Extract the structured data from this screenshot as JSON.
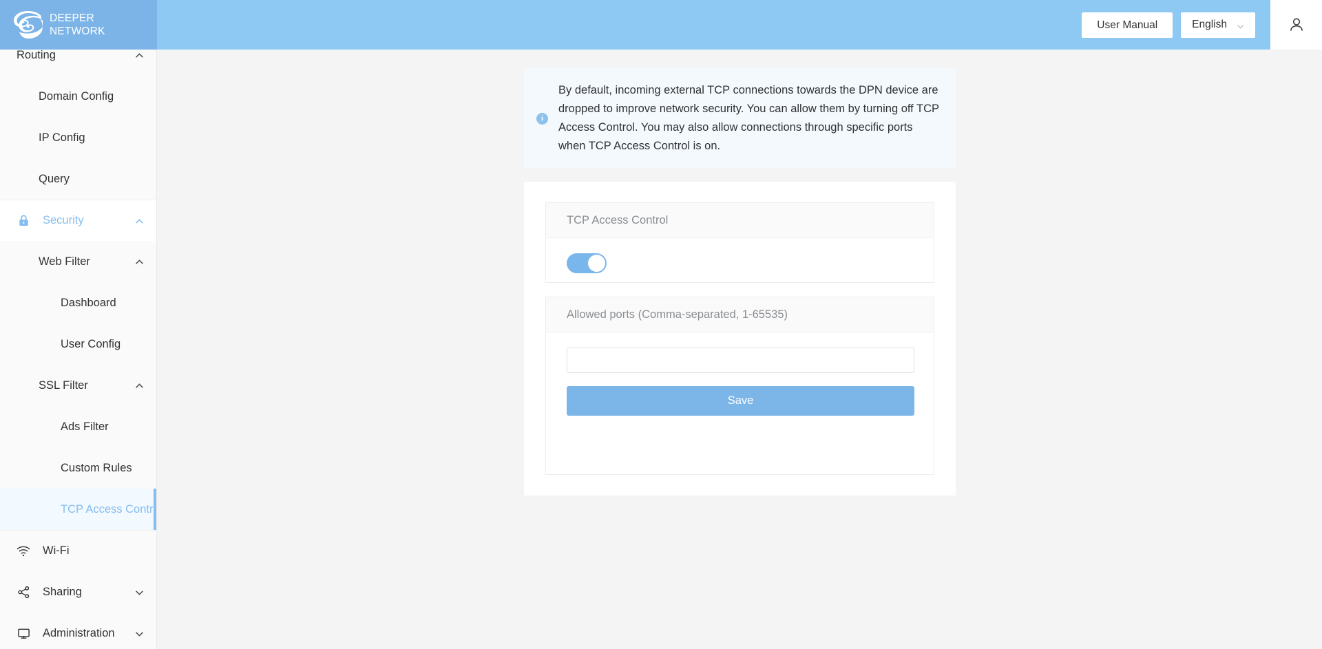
{
  "header": {
    "brand_name": "DEEPER\nNETWORK",
    "logo_icon": "deeper-spiral-logo",
    "user_manual_label": "User Manual",
    "language_value": "English",
    "language_caret_icon": "chevron-down-icon",
    "account_icon": "user-icon"
  },
  "sidebar": {
    "items": [
      {
        "label": "Routing",
        "level": "group",
        "icon": "",
        "caret": "chevron-up-icon",
        "active": false
      },
      {
        "label": "Domain Config",
        "level": "sub1",
        "icon": "",
        "caret": "",
        "active": false
      },
      {
        "label": "IP Config",
        "level": "sub1",
        "icon": "",
        "caret": "",
        "active": false
      },
      {
        "label": "Query",
        "level": "sub1",
        "icon": "",
        "caret": "",
        "active": false
      },
      {
        "label": "Security",
        "level": "group",
        "icon": "lock-icon",
        "caret": "chevron-up-icon",
        "active": false,
        "highlight": true
      },
      {
        "label": "Web Filter",
        "level": "sub1",
        "icon": "",
        "caret": "chevron-up-icon",
        "active": false
      },
      {
        "label": "Dashboard",
        "level": "sub2",
        "icon": "",
        "caret": "",
        "active": false
      },
      {
        "label": "User Config",
        "level": "sub2",
        "icon": "",
        "caret": "",
        "active": false
      },
      {
        "label": "SSL Filter",
        "level": "sub1",
        "icon": "",
        "caret": "chevron-up-icon",
        "active": false
      },
      {
        "label": "Ads Filter",
        "level": "sub2",
        "icon": "",
        "caret": "",
        "active": false
      },
      {
        "label": "Custom Rules",
        "level": "sub2",
        "icon": "",
        "caret": "",
        "active": false
      },
      {
        "label": "TCP Access Control",
        "level": "sub2",
        "icon": "",
        "caret": "",
        "active": true
      },
      {
        "label": "Wi-Fi",
        "level": "group",
        "icon": "wifi-icon",
        "caret": "",
        "active": false
      },
      {
        "label": "Sharing",
        "level": "group",
        "icon": "share-nodes-icon",
        "caret": "chevron-down-icon",
        "active": false
      },
      {
        "label": "Administration",
        "level": "group",
        "icon": "monitor-icon",
        "caret": "chevron-down-icon",
        "active": false
      }
    ]
  },
  "main": {
    "banner": {
      "icon": "info-circle-icon",
      "icon_glyph": "i",
      "text": "By default, incoming external TCP connections towards the DPN device are dropped to improve network security. You can allow them by turning off TCP Access Control. You may also allow connections through specific ports when TCP Access Control is on."
    },
    "access_card": {
      "title": "TCP Access Control",
      "toggle_on": true
    },
    "ports_card": {
      "title": "Allowed ports (Comma-separated, 1-65535)",
      "input_value": "",
      "input_placeholder": "",
      "save_label": "Save"
    }
  },
  "colors": {
    "brand_blue": "#7cb4e8",
    "header_blue": "#8ec9f3",
    "accent": "#85bdf0",
    "toggle_on": "#79b6ec",
    "save_button": "#7cb6e8",
    "banner_bg": "#f3f9fd",
    "content_bg": "#f4f4f4"
  }
}
